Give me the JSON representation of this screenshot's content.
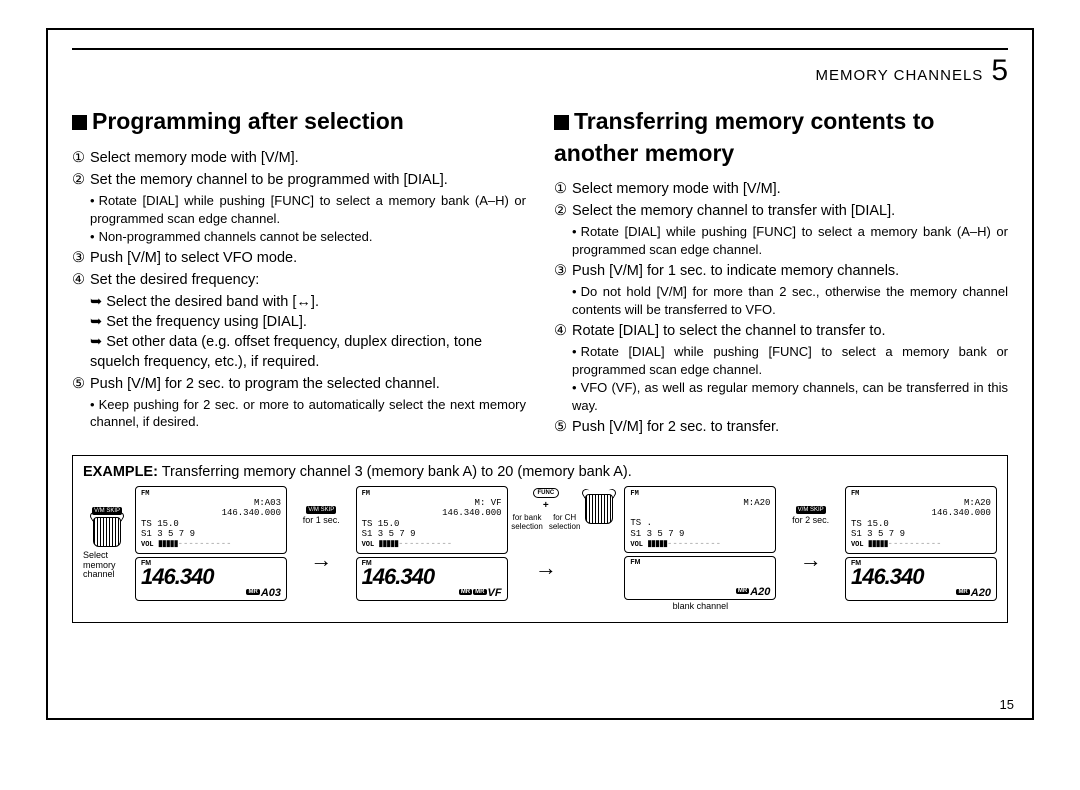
{
  "header": {
    "section": "MEMORY CHANNELS",
    "chapter": "5"
  },
  "left": {
    "title": "Programming after selection",
    "steps": {
      "s1": "Select memory mode with [V/M].",
      "s2": "Set the memory channel to be programmed with [DIAL].",
      "s2a": "Rotate [DIAL] while pushing [FUNC] to select a memory bank (A–H) or programmed scan edge channel.",
      "s2b": "Non-programmed channels cannot be selected.",
      "s3": "Push [V/M] to select VFO mode.",
      "s4": "Set the desired frequency:",
      "s4a": "Select the desired band with [↔].",
      "s4b": "Set the frequency using [DIAL].",
      "s4c": "Set other data (e.g. offset frequency, duplex direction, tone squelch frequency, etc.), if required.",
      "s5": "Push [V/M] for 2 sec. to program the selected channel.",
      "s5a": "Keep pushing for 2 sec. or more to automatically select the next memory channel, if desired."
    }
  },
  "right": {
    "title": "Transferring memory contents to another memory",
    "steps": {
      "s1": "Select memory mode with [V/M].",
      "s2": "Select the memory channel to transfer with [DIAL].",
      "s2a": "Rotate [DIAL] while pushing [FUNC] to select a memory bank (A–H) or programmed scan edge channel.",
      "s3": "Push [V/M] for 1 sec. to indicate memory channels.",
      "s3a": "Do not hold [V/M] for more than 2 sec., otherwise the memory channel contents will be transferred to VFO.",
      "s4": "Rotate [DIAL] to select the channel to transfer to.",
      "s4a": "Rotate [DIAL] while pushing [FUNC] to select a memory bank or programmed scan edge channel.",
      "s4b": "VFO (VF), as well as regular memory channels, can be transferred in this way.",
      "s5": "Push [V/M] for 2 sec. to transfer."
    }
  },
  "example": {
    "label": "EXAMPLE:",
    "text": "Transferring memory channel 3 (memory bank A) to 20 (memory bank A).",
    "knob1_btn": "V/M SKIP",
    "knob1_cap": "Select memory channel",
    "step1_cap": "for 1 sec.",
    "step1_btn": "V/M SKIP",
    "func": "FUNC",
    "bank_cap": "for bank selection",
    "ch_cap": "for CH selection",
    "step3_btn": "V/M SKIP",
    "step3_cap": "for 2 sec.",
    "blank_cap": "blank channel",
    "lcd": {
      "a": {
        "top": "M:A03",
        "freq": "146.340.000",
        "ts": "TS    15.0",
        "s": "S1  3  5  7  9",
        "big": "146.340",
        "mr": "A03"
      },
      "b": {
        "top": "M: VF",
        "freq": "146.340.000",
        "ts": "TS    15.0",
        "s": "S1  3  5  7  9",
        "big": "146.340",
        "mr": "VF"
      },
      "c": {
        "top": "M:A20",
        "freq": "",
        "ts": "TS      .",
        "s": "S1  3  5  7  9",
        "big": "",
        "mr": "A20"
      },
      "d": {
        "top": "M:A20",
        "freq": "146.340.000",
        "ts": "TS    15.0",
        "s": "S1  3  5  7  9",
        "big": "146.340",
        "mr": "A20"
      }
    }
  },
  "pagenum": "15",
  "circled": {
    "1": "①",
    "2": "②",
    "3": "③",
    "4": "④",
    "5": "⑤"
  }
}
